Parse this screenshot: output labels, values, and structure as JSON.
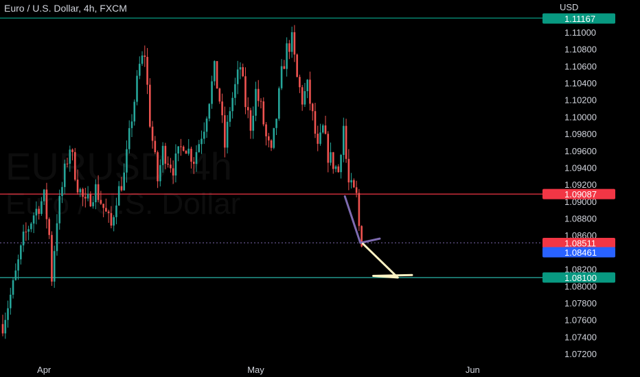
{
  "header": {
    "title": "Euro / U.S. Dollar, 4h, FXCM"
  },
  "watermark": {
    "line1": "EURUSD, 4h",
    "line2": "Euro / U.S. Dollar"
  },
  "colors": {
    "up": "#26a69a",
    "down": "#ef5350",
    "background": "#000000",
    "resistance_line": "#f23645",
    "support_line": "#26a69a",
    "top_line": "#089981",
    "arrow_purple": "#7e6bb0",
    "arrow_yellow": "#fff3c4",
    "tag_top": "#089981",
    "tag_resistance": "#f23645",
    "tag_bid": "#f23645",
    "tag_ask": "#2962ff",
    "tag_support": "#089981"
  },
  "chart_data": {
    "type": "candlestick",
    "title": "Euro / U.S. Dollar, 4h, FXCM",
    "y_axis": {
      "unit_label": "USD",
      "min": 1.0705,
      "max": 1.115,
      "side": "right",
      "ticks": [
        "1.11000",
        "1.10800",
        "1.10600",
        "1.10400",
        "1.10200",
        "1.10000",
        "1.09800",
        "1.09600",
        "1.09400",
        "1.09200",
        "1.09000",
        "1.08800",
        "1.08600",
        "1.08200",
        "1.08000",
        "1.07800",
        "1.07600",
        "1.07400",
        "1.07200"
      ]
    },
    "x_axis": {
      "ticks": [
        {
          "label": "Apr",
          "index": 16
        },
        {
          "label": "May",
          "index": 98
        },
        {
          "label": "Jun",
          "index": 182
        }
      ]
    },
    "candle_count": 134,
    "anchors": [
      [
        0,
        1.0755
      ],
      [
        4,
        1.08
      ],
      [
        8,
        1.0855
      ],
      [
        12,
        1.0885
      ],
      [
        16,
        1.0905
      ],
      [
        18,
        1.086
      ],
      [
        19,
        1.081
      ],
      [
        21,
        1.088
      ],
      [
        24,
        1.0935
      ],
      [
        26,
        1.0965
      ],
      [
        29,
        1.092
      ],
      [
        32,
        1.0895
      ],
      [
        36,
        1.0915
      ],
      [
        40,
        1.0885
      ],
      [
        42,
        1.087
      ],
      [
        44,
        1.0905
      ],
      [
        47,
        1.093
      ],
      [
        50,
        1.1
      ],
      [
        53,
        1.106
      ],
      [
        55,
        1.1075
      ],
      [
        57,
        1.0995
      ],
      [
        60,
        1.0925
      ],
      [
        62,
        1.096
      ],
      [
        66,
        1.094
      ],
      [
        70,
        1.097
      ],
      [
        74,
        1.095
      ],
      [
        78,
        1.099
      ],
      [
        82,
        1.1055
      ],
      [
        84,
        1.102
      ],
      [
        86,
        1.0965
      ],
      [
        88,
        1.101
      ],
      [
        92,
        1.106
      ],
      [
        94,
        1.1015
      ],
      [
        96,
        1.099
      ],
      [
        98,
        1.103
      ],
      [
        100,
        1.101
      ],
      [
        102,
        1.0975
      ],
      [
        104,
        1.0955
      ],
      [
        106,
        1.1
      ],
      [
        108,
        1.105
      ],
      [
        110,
        1.108
      ],
      [
        112,
        1.109
      ],
      [
        114,
        1.1045
      ],
      [
        116,
        1.102
      ],
      [
        118,
        1.1035
      ],
      [
        120,
        1.1
      ],
      [
        122,
        1.096
      ],
      [
        124,
        1.0985
      ],
      [
        126,
        1.0955
      ],
      [
        128,
        1.0945
      ],
      [
        130,
        1.0935
      ],
      [
        131,
        1.0965
      ],
      [
        132,
        1.099
      ],
      [
        133,
        1.095
      ],
      [
        134,
        1.092
      ],
      [
        135,
        1.0915
      ],
      [
        137,
        1.0905
      ],
      [
        138,
        1.087
      ],
      [
        139,
        1.0855
      ],
      [
        140,
        1.0852
      ]
    ],
    "horizontal_levels": [
      {
        "price": 1.11167,
        "label": "1.11167",
        "color_key": "top_line",
        "tag_color_key": "tag_top"
      },
      {
        "price": 1.09087,
        "label": "1.09087",
        "color_key": "resistance_line",
        "tag_color_key": "tag_resistance"
      },
      {
        "price": 1.08511,
        "label": "1.08511",
        "color_key": null,
        "tag_color_key": "tag_bid",
        "dashed": true
      },
      {
        "price": 1.08461,
        "label": "1.08461",
        "color_key": null,
        "tag_color_key": "tag_ask"
      },
      {
        "price": 1.081,
        "label": "1.08100",
        "color_key": "support_line",
        "tag_color_key": "tag_support"
      }
    ],
    "drawings": [
      {
        "type": "arrow",
        "color_key": "arrow_purple",
        "points": [
          [
            132.5,
            1.0906
          ],
          [
            138.5,
            1.0851
          ],
          [
            146,
            1.0856
          ]
        ]
      },
      {
        "type": "arrow",
        "color_key": "arrow_yellow",
        "points": [
          [
            139.5,
            1.085
          ],
          [
            153,
            1.081
          ],
          [
            143.5,
            1.0812
          ],
          [
            158.5,
            1.0813
          ]
        ]
      }
    ]
  }
}
